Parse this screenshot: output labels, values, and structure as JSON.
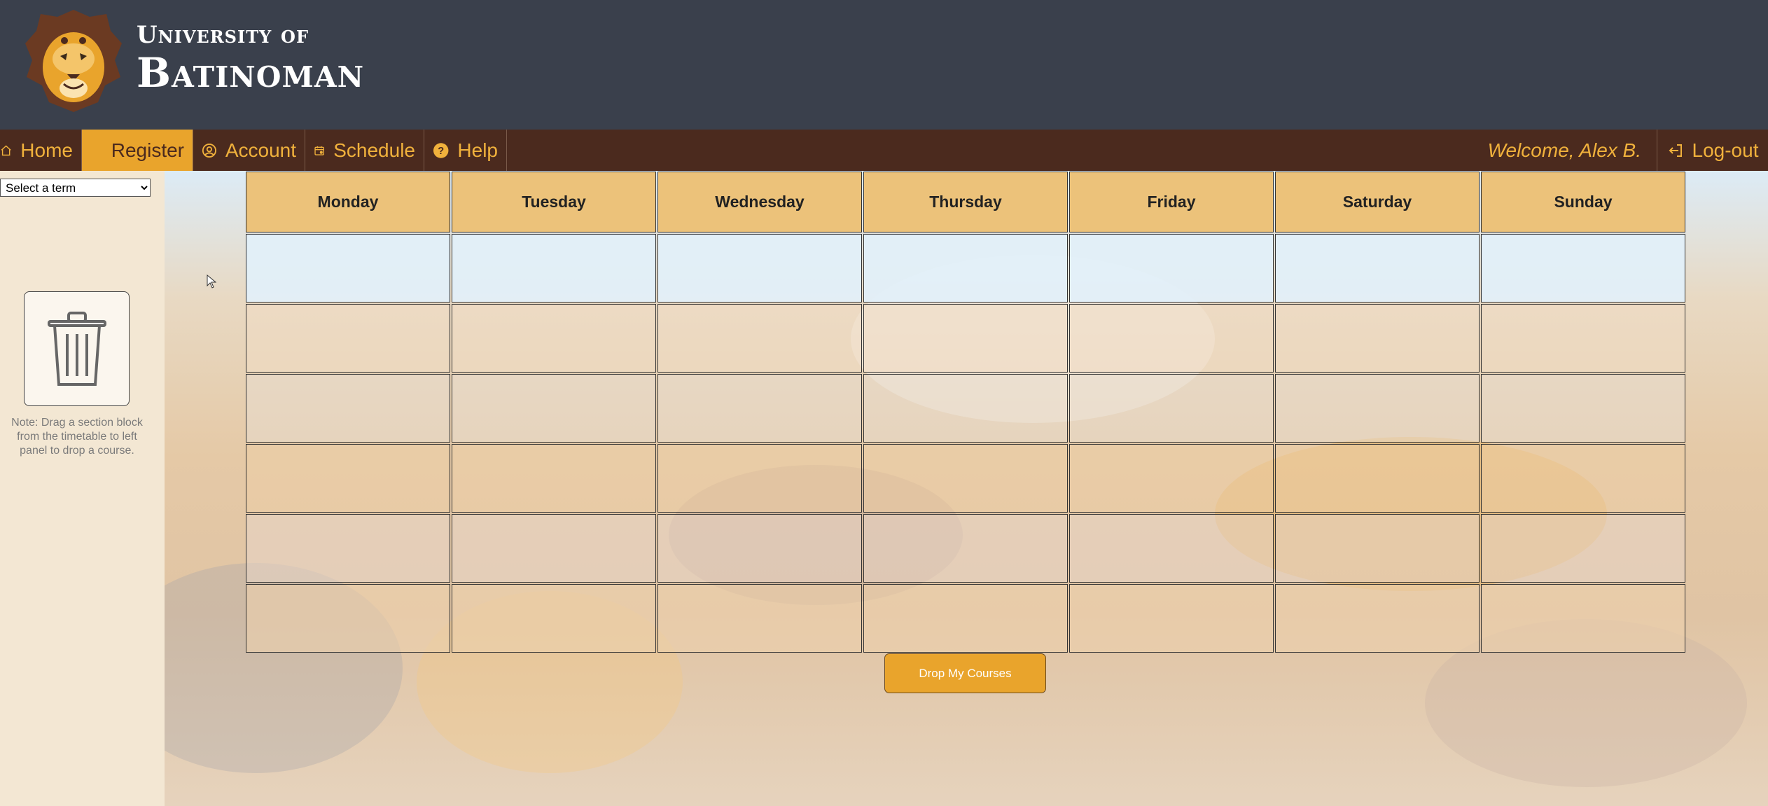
{
  "brand": {
    "line1": "University of",
    "line2": "Batinoman"
  },
  "nav": {
    "items": [
      {
        "label": "Home",
        "icon": "home-icon"
      },
      {
        "label": "Register",
        "icon": "",
        "active": true
      },
      {
        "label": "Account",
        "icon": "account-icon"
      },
      {
        "label": "Schedule",
        "icon": "calendar-icon"
      },
      {
        "label": "Help",
        "icon": "help-icon"
      }
    ],
    "welcome": "Welcome, Alex B.",
    "logout": "Log-out"
  },
  "sidebar": {
    "term_select": {
      "selected": "Select a term",
      "options": [
        "Select a term"
      ]
    },
    "trash_icon": "trash-icon",
    "note": "Note: Drag a section block from the timetable to left panel to drop a course."
  },
  "timetable": {
    "days": [
      "Monday",
      "Tuesday",
      "Wednesday",
      "Thursday",
      "Friday",
      "Saturday",
      "Sunday"
    ],
    "rows": 6
  },
  "actions": {
    "drop_label": "Drop My Courses"
  },
  "colors": {
    "header_bg": "#3a404c",
    "nav_bg": "#4b2a1e",
    "accent": "#e9a42c",
    "nav_text": "#f0b13c",
    "day_header_bg": "#ecc27a"
  }
}
